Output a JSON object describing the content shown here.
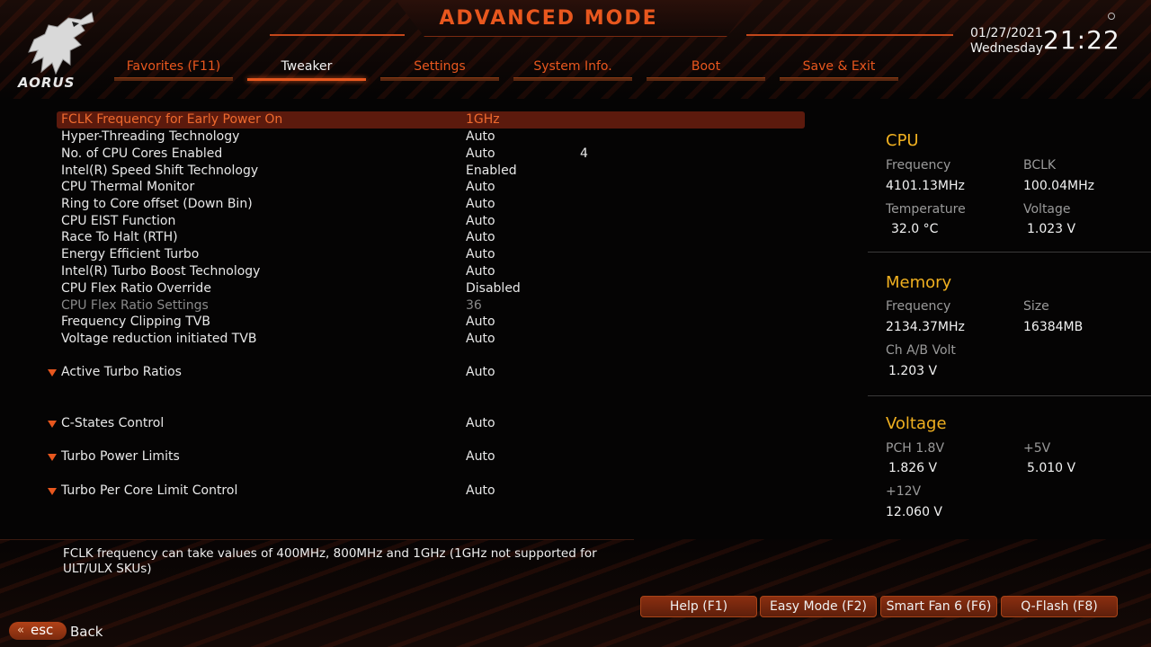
{
  "header": {
    "title": "ADVANCED MODE",
    "brand": "AORUS",
    "date": "01/27/2021",
    "weekday": "Wednesday",
    "time": "21:22"
  },
  "tabs": [
    {
      "label": "Favorites (F11)",
      "active": false
    },
    {
      "label": "Tweaker",
      "active": true
    },
    {
      "label": "Settings",
      "active": false
    },
    {
      "label": "System Info.",
      "active": false
    },
    {
      "label": "Boot",
      "active": false
    },
    {
      "label": "Save & Exit",
      "active": false
    }
  ],
  "settings": [
    {
      "label": "FCLK Frequency for Early Power On",
      "value": "1GHz",
      "extra": "",
      "selected": true
    },
    {
      "label": "Hyper-Threading Technology",
      "value": "Auto",
      "extra": ""
    },
    {
      "label": "No. of CPU Cores Enabled",
      "value": "Auto",
      "extra": "4"
    },
    {
      "label": "Intel(R) Speed Shift Technology",
      "value": "Enabled",
      "extra": ""
    },
    {
      "label": "CPU Thermal Monitor",
      "value": "Auto",
      "extra": ""
    },
    {
      "label": "Ring to Core offset (Down Bin)",
      "value": "Auto",
      "extra": ""
    },
    {
      "label": "CPU EIST Function",
      "value": "Auto",
      "extra": ""
    },
    {
      "label": "Race To Halt (RTH)",
      "value": "Auto",
      "extra": ""
    },
    {
      "label": "Energy Efficient Turbo",
      "value": "Auto",
      "extra": ""
    },
    {
      "label": "Intel(R) Turbo Boost Technology",
      "value": "Auto",
      "extra": ""
    },
    {
      "label": "CPU Flex Ratio Override",
      "value": "Disabled",
      "extra": ""
    },
    {
      "label": "CPU Flex Ratio Settings",
      "value": "36",
      "extra": "",
      "disabled": true
    },
    {
      "label": "Frequency Clipping TVB",
      "value": "Auto",
      "extra": ""
    },
    {
      "label": "Voltage reduction initiated TVB",
      "value": "Auto",
      "extra": ""
    }
  ],
  "submenus": [
    {
      "label": "Active Turbo Ratios",
      "value": "Auto"
    },
    {
      "label": "C-States Control",
      "value": "Auto"
    },
    {
      "label": "Turbo Power Limits",
      "value": "Auto"
    },
    {
      "label": "Turbo Per Core Limit Control",
      "value": "Auto"
    }
  ],
  "help_text": "FCLK frequency can take values of 400MHz, 800MHz  and 1GHz (1GHz not supported for ULT/ULX SKUs)",
  "monitor": {
    "cpu": {
      "title": "CPU",
      "frequency_label": "Frequency",
      "frequency": "4101.13MHz",
      "bclk_label": "BCLK",
      "bclk": "100.04MHz",
      "temperature_label": "Temperature",
      "temperature": "32.0 °C",
      "voltage_label": "Voltage",
      "voltage": "1.023 V"
    },
    "memory": {
      "title": "Memory",
      "frequency_label": "Frequency",
      "frequency": "2134.37MHz",
      "size_label": "Size",
      "size": "16384MB",
      "chab_label": "Ch A/B Volt",
      "chab": "1.203 V"
    },
    "voltage": {
      "title": "Voltage",
      "pch_label": "PCH 1.8V",
      "pch": "1.826 V",
      "p5v_label": "+5V",
      "p5v": "5.010 V",
      "p12v_label": "+12V",
      "p12v": "12.060 V"
    }
  },
  "footer": {
    "buttons": [
      "Help (F1)",
      "Easy Mode (F2)",
      "Smart Fan 6 (F6)",
      "Q-Flash (F8)"
    ],
    "esc_label": "esc",
    "back_label": "Back"
  },
  "colors": {
    "accent": "#e8571e",
    "section_title": "#f0b020",
    "selected_row_bg": "#5c1a0d"
  }
}
